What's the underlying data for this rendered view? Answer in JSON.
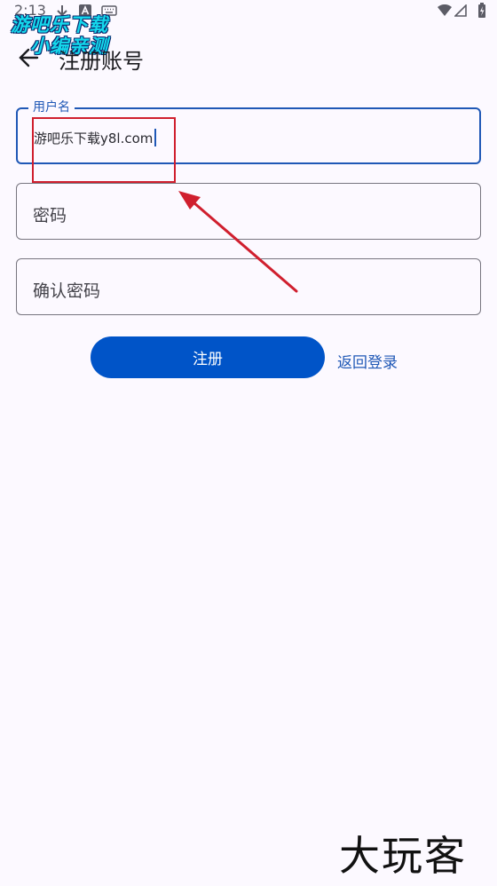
{
  "status_bar": {
    "time": "2:13",
    "icons": [
      "download-icon",
      "text-a-icon",
      "keyboard-icon",
      "wifi-icon",
      "cellular-icon",
      "battery-icon"
    ]
  },
  "watermark_top": {
    "line1": "游吧乐下载",
    "line2": "小编亲测"
  },
  "header": {
    "title": "注册账号",
    "back_icon": "arrow-left-icon"
  },
  "form": {
    "username": {
      "label": "用户名",
      "value": "游吧乐下载y8l.com"
    },
    "password": {
      "placeholder": "密码"
    },
    "confirm_password": {
      "placeholder": "确认密码"
    }
  },
  "actions": {
    "register_label": "注册",
    "back_to_login_label": "返回登录"
  },
  "watermark_bottom": "大玩客",
  "colors": {
    "background": "#fcf9ff",
    "primary": "#0054c8",
    "focus_border": "#1f58b6",
    "annotation_red": "#d01f2e"
  }
}
